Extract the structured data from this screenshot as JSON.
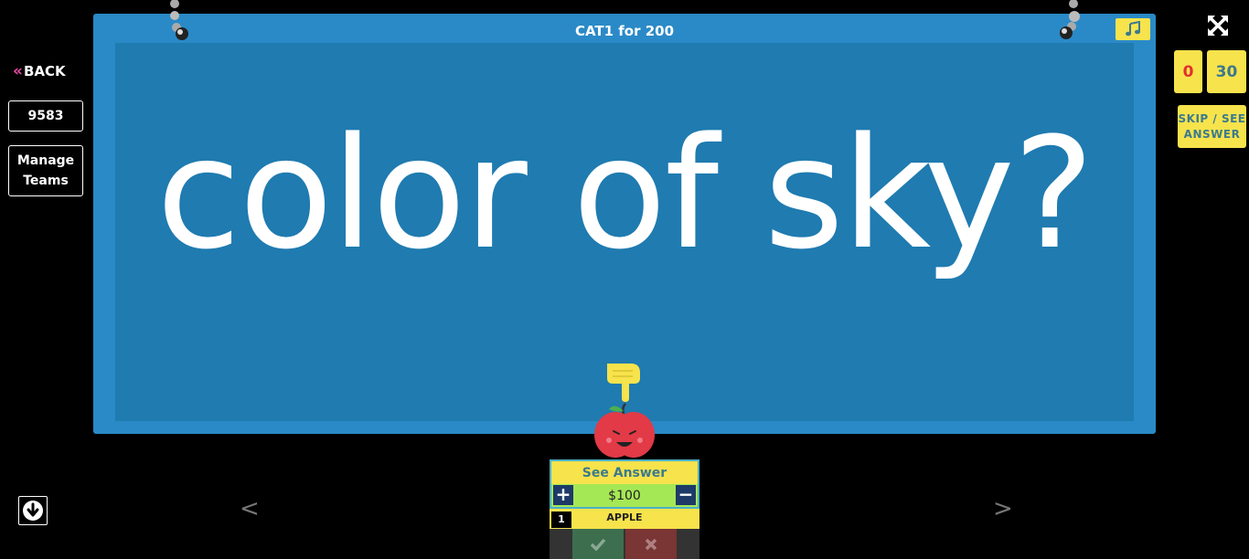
{
  "nav": {
    "back_label": "BACK",
    "back_icon": "double-chevron-left-icon"
  },
  "sidebar": {
    "game_code": "9583",
    "manage_teams_label": "Manage Teams"
  },
  "board": {
    "title": "CAT1 for 200",
    "question": "color of sky?",
    "music_icon": "music-note-icon"
  },
  "controls": {
    "expand_icon": "expand-icon",
    "score": "0",
    "timer": "30",
    "skip_label": "SKIP / SEE ANSWER"
  },
  "pager": {
    "prev_label": "<",
    "next_label": ">"
  },
  "team_panel": {
    "see_answer_label": "See Answer",
    "plus_label": "+",
    "minus_label": "−",
    "amount": "$100",
    "team_number": "1",
    "team_name": "APPLE",
    "correct_icon": "checkmark-icon",
    "wrong_icon": "x-icon"
  },
  "colors": {
    "board_outer": "#2a8ac7",
    "board_inner": "#1f7bb0",
    "accent_yellow": "#f7e34c",
    "score_red": "#e32f2f",
    "amount_green": "#a5e856",
    "back_chevron": "#e64aa0"
  }
}
